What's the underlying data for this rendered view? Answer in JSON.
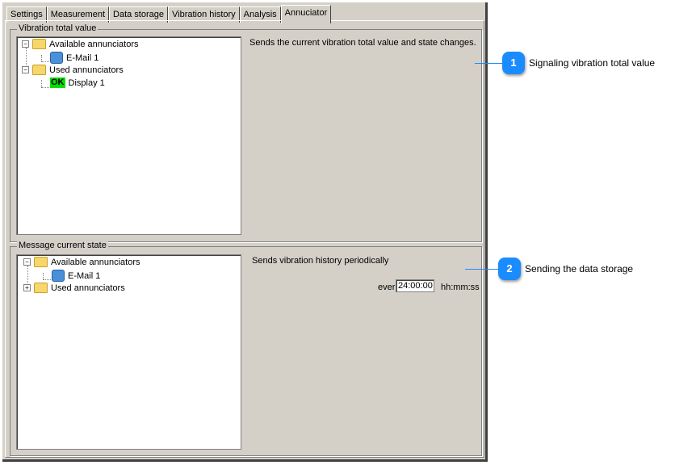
{
  "tabs": [
    "Settings",
    "Measurement",
    "Data storage",
    "Vibration history",
    "Analysis",
    "Annuciator"
  ],
  "active_tab": "Annuciator",
  "group1": {
    "title": "Vibration total value",
    "description": "Sends the current vibration total value and state changes.",
    "tree": {
      "available": "Available annunciators",
      "available_items": [
        "E-Mail 1"
      ],
      "used": "Used annunciators",
      "used_items": [
        {
          "badge": "OK",
          "label": "Display 1"
        }
      ]
    }
  },
  "group2": {
    "title": "Message current state",
    "description": "Sends vibration history periodically",
    "tree": {
      "available": "Available annunciators",
      "available_items": [
        "E-Mail 1"
      ],
      "used": "Used annunciators"
    },
    "interval_prefix": "ever",
    "interval_value": "24:00:00",
    "interval_unit": "hh:mm:ss"
  },
  "callouts": [
    {
      "number": "1",
      "label": "Signaling vibration total value"
    },
    {
      "number": "2",
      "label": "Sending the data storage"
    }
  ],
  "colors": {
    "callout": "#1a8cff",
    "ok_badge": "#00e000"
  }
}
